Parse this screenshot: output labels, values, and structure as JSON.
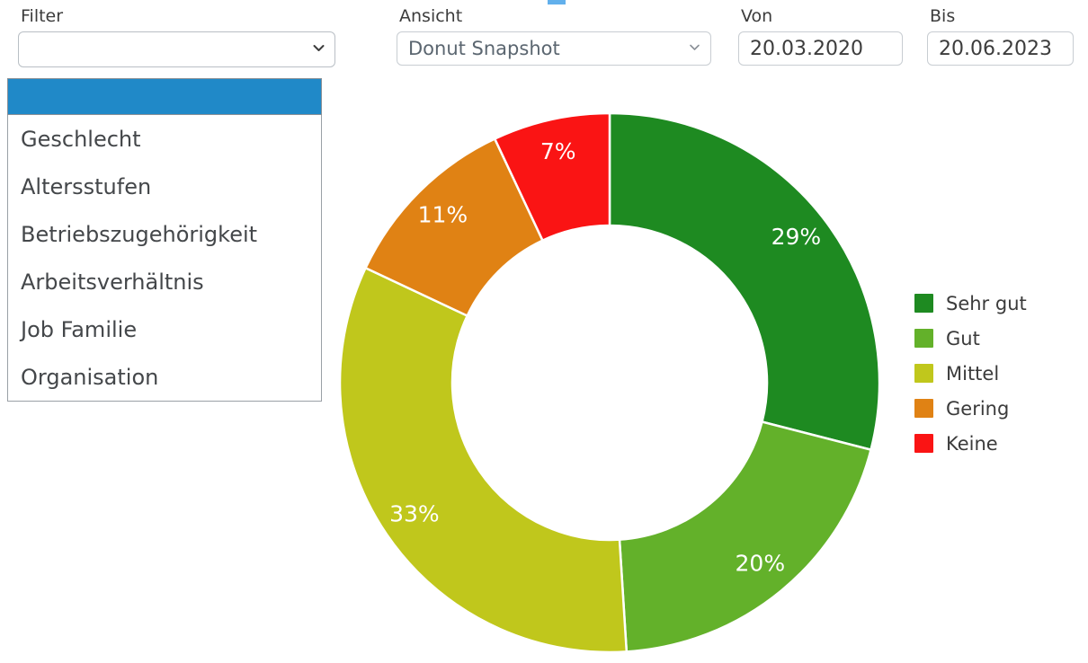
{
  "toolbar": {
    "filter": {
      "label": "Filter",
      "value": "",
      "icon": "chevron-down-icon"
    },
    "ansicht": {
      "label": "Ansicht",
      "value": "Donut Snapshot",
      "icon": "chevron-down-icon"
    },
    "von": {
      "label": "Von",
      "value": "20.03.2020"
    },
    "bis": {
      "label": "Bis",
      "value": "20.06.2023"
    }
  },
  "filter_dropdown": {
    "open": true,
    "selected_index": 0,
    "highlight_color": "#2089c8",
    "options": [
      "",
      "Geschlecht",
      "Altersstufen",
      "Betriebszugehörigkeit",
      "Arbeitsverhältnis",
      "Job Familie",
      "Organisation"
    ]
  },
  "chart_data": {
    "type": "pie",
    "variant": "donut",
    "title": "",
    "categories": [
      "Sehr gut",
      "Gut",
      "Mittel",
      "Gering",
      "Keine"
    ],
    "values": [
      29,
      20,
      33,
      11,
      7
    ],
    "value_labels": [
      "29%",
      "20%",
      "33%",
      "11%",
      "7%"
    ],
    "colors": [
      "#1e8a21",
      "#63b12a",
      "#c0c71c",
      "#e08214",
      "#fa1414"
    ],
    "legend_position": "right",
    "legend_entries": [
      "Sehr gut",
      "Gut",
      "Mittel",
      "Gering",
      "Keine"
    ],
    "start_angle_deg": 0,
    "direction": "clockwise",
    "inner_radius": 175,
    "outer_radius": 300,
    "center": [
      678,
      426
    ],
    "label_color": "#ffffff",
    "slice_gap_color": "#ffffff"
  }
}
